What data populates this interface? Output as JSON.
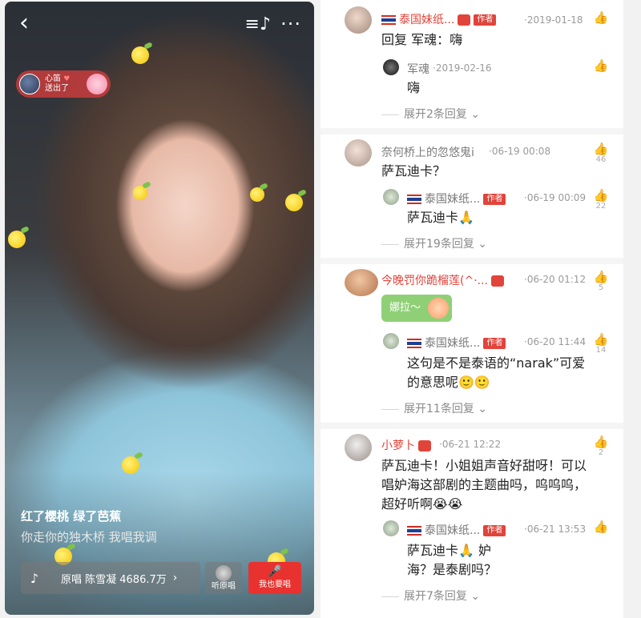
{
  "video": {
    "gift": {
      "line1": "心笛",
      "line2": "送出了"
    },
    "song_title": "红了樱桃 绿了芭蕉",
    "lyric": "你走你的独木桥 我唱我调",
    "music": {
      "text": "原唱 陈雪凝 4686.7万"
    },
    "listen_label": "听原唱",
    "sing_label": "我也要唱"
  },
  "comments": {
    "c1": {
      "name": "泰国妹纸...",
      "tag": "作者",
      "time": "·2019-01-18",
      "body": "回复 军魂：嗨"
    },
    "c1r": {
      "name": "军魂",
      "time": "·2019-02-16",
      "body": "嗨"
    },
    "c1e": "展开2条回复",
    "c2": {
      "name": "奈何桥上的忽悠鬼i",
      "time": "·06-19 00:08",
      "body": "萨瓦迪卡？",
      "likes": "46"
    },
    "c2r": {
      "name": "泰国妹纸...",
      "tag": "作者",
      "time": "·06-19 00:09",
      "body": "萨瓦迪卡🙏",
      "likes": "22"
    },
    "c2e": "展开19条回复",
    "c3": {
      "name": "今晚罚你跪榴莲(^·...",
      "time": "·06-20 01:12",
      "sticker": "娜拉～",
      "likes": "5"
    },
    "c3r": {
      "name": "泰国妹纸...",
      "tag": "作者",
      "time": "·06-20 11:44",
      "body": "这句是不是泰语的“narak”可爱的意思呢🙂🙂",
      "likes": "14"
    },
    "c3e": "展开11条回复",
    "c4": {
      "name": "小萝卜",
      "time": "·06-21 12:22",
      "body": "萨瓦迪卡！小姐姐声音好甜呀！可以唱妒海这部剧的主题曲吗，呜呜呜，超好听啊😭😭",
      "likes": "2"
    },
    "c4r": {
      "name": "泰国妹纸...",
      "tag": "作者",
      "time": "·06-21 13:53",
      "body": "萨瓦迪卡🙏 妒海？是泰剧吗？"
    },
    "c4e": "展开7条回复"
  }
}
